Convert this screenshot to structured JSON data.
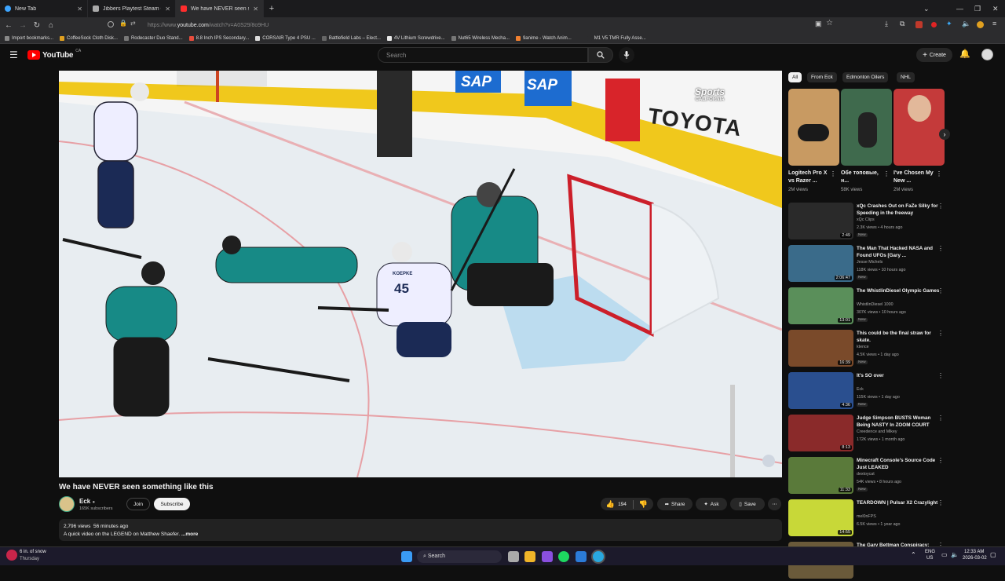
{
  "browser": {
    "tabs": [
      {
        "label": "New Tab",
        "color": "#3da5ff"
      },
      {
        "label": "Jibbers Playtest Steam Charts (F...",
        "color": "#aaaaaa"
      },
      {
        "label": "We have NEVER seen something...",
        "color": "#ff2d2d"
      }
    ],
    "url_prefix": "https://www.",
    "url_host": "youtube.com",
    "url_path": "/watch?v=A0S29/8o9HU",
    "bookmarks": [
      "Import bookmarks...",
      "CoffeeSock Cloth Disk...",
      "Rodecaster Duo Stand...",
      "8.8 Inch IPS Secondary...",
      "CORSAIR Type 4 PSU ...",
      "Battlefield Labs – Elect...",
      "4V Lithium Screwdrive...",
      "Nut65 Wireless Mecha...",
      "9anime - Watch Anim...",
      "M1 V5 TMR Fully Asse..."
    ]
  },
  "yt": {
    "logo": "YouTube",
    "region": "CA",
    "search_placeholder": "Search",
    "create_label": "Create",
    "brand_red": "#ff0000"
  },
  "video": {
    "overlay_brand": "Sports",
    "overlay_region": "CALIFORNIA",
    "ad_sap": "SAP",
    "ad_toyota": "TOYOTA",
    "jersey_number": "45",
    "jersey_name": "KOEPKE",
    "title": "We have NEVER seen something like this",
    "channel": "Eck",
    "subscribers": "165K subscribers",
    "join_label": "Join",
    "subscribe_label": "Subscribe",
    "likes": "194",
    "share_label": "Share",
    "ask_label": "Ask",
    "save_label": "Save",
    "views": "2,796 views",
    "age": "56 minutes ago",
    "description": "A quick video on the LEGEND on Matthew Shaefer.",
    "more_label": "...more"
  },
  "chips": [
    "All",
    "From Eck",
    "Edmonton Oilers",
    "NHL"
  ],
  "shorts": [
    {
      "title": "Logitech Pro X vs Razer ...",
      "views": "2M views"
    },
    {
      "title": "Обе топовые, н...",
      "views": "58K views"
    },
    {
      "title": "I've Chosen My New ...",
      "views": "2M views"
    }
  ],
  "recommended": [
    {
      "title": "xQc Crashes Out on FaZe Silky for Speeding in the freeway",
      "channel": "xQc Clips",
      "meta": "2.3K views • 4 hours ago",
      "badge": "New",
      "duration": "2:49",
      "thumb": "#2a2a2a"
    },
    {
      "title": "The Man That Hacked NASA and Found UFOs [Gary ...",
      "channel": "Jesse Michels",
      "meta": "118K views • 10 hours ago",
      "badge": "New",
      "duration": "2:06:47",
      "thumb": "#3a6b8a"
    },
    {
      "title": "The WhistlinDiesel Olympic Games",
      "channel": "WhistlinDiesel 1000",
      "meta": "307K views • 10 hours ago",
      "badge": "New",
      "duration": "13:01",
      "thumb": "#5a8f5a"
    },
    {
      "title": "This could be the final straw for skate.",
      "channel": "ktence",
      "meta": "4.5K views • 1 day ago",
      "badge": "New",
      "duration": "16:39",
      "thumb": "#7a4a2a"
    },
    {
      "title": "It's SO over",
      "channel": "Eck",
      "meta": "115K views • 1 day ago",
      "badge": "New",
      "duration": "4:36",
      "thumb": "#2a4f8f"
    },
    {
      "title": "Judge Simpson BUSTS Woman Being NASTY In ZOOM COURT",
      "channel": "Creedence and Mikey",
      "meta": "172K views • 1 month ago",
      "badge": "",
      "duration": "8:13",
      "thumb": "#8a2a2a"
    },
    {
      "title": "Minecraft Console's Source Code Just LEAKED",
      "channel": "dextoycat",
      "meta": "54K views • 8 hours ago",
      "badge": "New",
      "duration": "11:33",
      "thumb": "#5a7a3a"
    },
    {
      "title": "TEARDOWN | Pulsar X2 Crazylight",
      "channel": "mel0nFPS",
      "meta": "6.5K views • 1 year ago",
      "badge": "",
      "duration": "14:55",
      "thumb": "#c8d838"
    },
    {
      "title": "The Gary Bettman Conspiracy: Why Can't Canada Win the...",
      "channel": "",
      "meta": "",
      "badge": "",
      "duration": "",
      "thumb": "#6a5a3a"
    }
  ],
  "taskbar": {
    "weather_temp": "6 in. of snow",
    "weather_day": "Thursday",
    "search_label": "Search",
    "lang": "ENG",
    "region": "US",
    "time": "12:33 AM",
    "date": "2026-03-02"
  }
}
